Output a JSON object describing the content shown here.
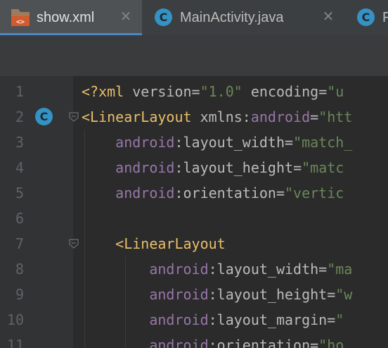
{
  "tabs": [
    {
      "label": "show.xml",
      "icon": "xml-file-icon",
      "active": true
    },
    {
      "label": "MainActivity.java",
      "icon": "java-class-icon",
      "active": false
    },
    {
      "label": "",
      "icon": "java-class-icon",
      "active": false,
      "partial_label": "F"
    }
  ],
  "tab_close_glyph": "✕",
  "class_glyph": "C",
  "colors": {
    "tag": "#e8bf6a",
    "namespace": "#9876aa",
    "attribute": "#bababa",
    "string": "#6a8759",
    "line_number": "#606366",
    "tab_underline": "#4a88c7"
  },
  "editor": {
    "line_numbers": [
      "1",
      "2",
      "3",
      "4",
      "5",
      "6",
      "7",
      "8",
      "9",
      "10",
      "11"
    ],
    "lines": [
      {
        "parts": [
          [
            "tag",
            "<?xml "
          ],
          [
            "attr",
            "version"
          ],
          [
            "punct",
            "="
          ],
          [
            "val",
            "\"1.0\""
          ],
          [
            "punct",
            " "
          ],
          [
            "attr",
            "encoding"
          ],
          [
            "punct",
            "="
          ],
          [
            "val",
            "\"u"
          ]
        ]
      },
      {
        "parts": [
          [
            "tag",
            "<LinearLayout "
          ],
          [
            "attr",
            "xmlns"
          ],
          [
            "punct",
            ":"
          ],
          [
            "ns",
            "android"
          ],
          [
            "punct",
            "="
          ],
          [
            "val",
            "\"htt"
          ]
        ]
      },
      {
        "parts": [
          [
            "punct",
            "    "
          ],
          [
            "ns",
            "android"
          ],
          [
            "punct",
            ":"
          ],
          [
            "attr",
            "layout_width"
          ],
          [
            "punct",
            "="
          ],
          [
            "val",
            "\"match_"
          ]
        ]
      },
      {
        "parts": [
          [
            "punct",
            "    "
          ],
          [
            "ns",
            "android"
          ],
          [
            "punct",
            ":"
          ],
          [
            "attr",
            "layout_height"
          ],
          [
            "punct",
            "="
          ],
          [
            "val",
            "\"matc"
          ]
        ]
      },
      {
        "parts": [
          [
            "punct",
            "    "
          ],
          [
            "ns",
            "android"
          ],
          [
            "punct",
            ":"
          ],
          [
            "attr",
            "orientation"
          ],
          [
            "punct",
            "="
          ],
          [
            "val",
            "\"vertic"
          ]
        ]
      },
      {
        "parts": []
      },
      {
        "parts": [
          [
            "punct",
            "    "
          ],
          [
            "tag",
            "<LinearLayout"
          ]
        ]
      },
      {
        "parts": [
          [
            "punct",
            "        "
          ],
          [
            "ns",
            "android"
          ],
          [
            "punct",
            ":"
          ],
          [
            "attr",
            "layout_width"
          ],
          [
            "punct",
            "="
          ],
          [
            "val",
            "\"ma"
          ]
        ]
      },
      {
        "parts": [
          [
            "punct",
            "        "
          ],
          [
            "ns",
            "android"
          ],
          [
            "punct",
            ":"
          ],
          [
            "attr",
            "layout_height"
          ],
          [
            "punct",
            "="
          ],
          [
            "val",
            "\"w"
          ]
        ]
      },
      {
        "parts": [
          [
            "punct",
            "        "
          ],
          [
            "ns",
            "android"
          ],
          [
            "punct",
            ":"
          ],
          [
            "attr",
            "layout_margin"
          ],
          [
            "punct",
            "="
          ],
          [
            "val",
            "\""
          ]
        ]
      },
      {
        "parts": [
          [
            "punct",
            "        "
          ],
          [
            "ns",
            "android"
          ],
          [
            "punct",
            ":"
          ],
          [
            "attr",
            "orientation"
          ],
          [
            "punct",
            "="
          ],
          [
            "val",
            "\"ho"
          ]
        ]
      }
    ]
  }
}
